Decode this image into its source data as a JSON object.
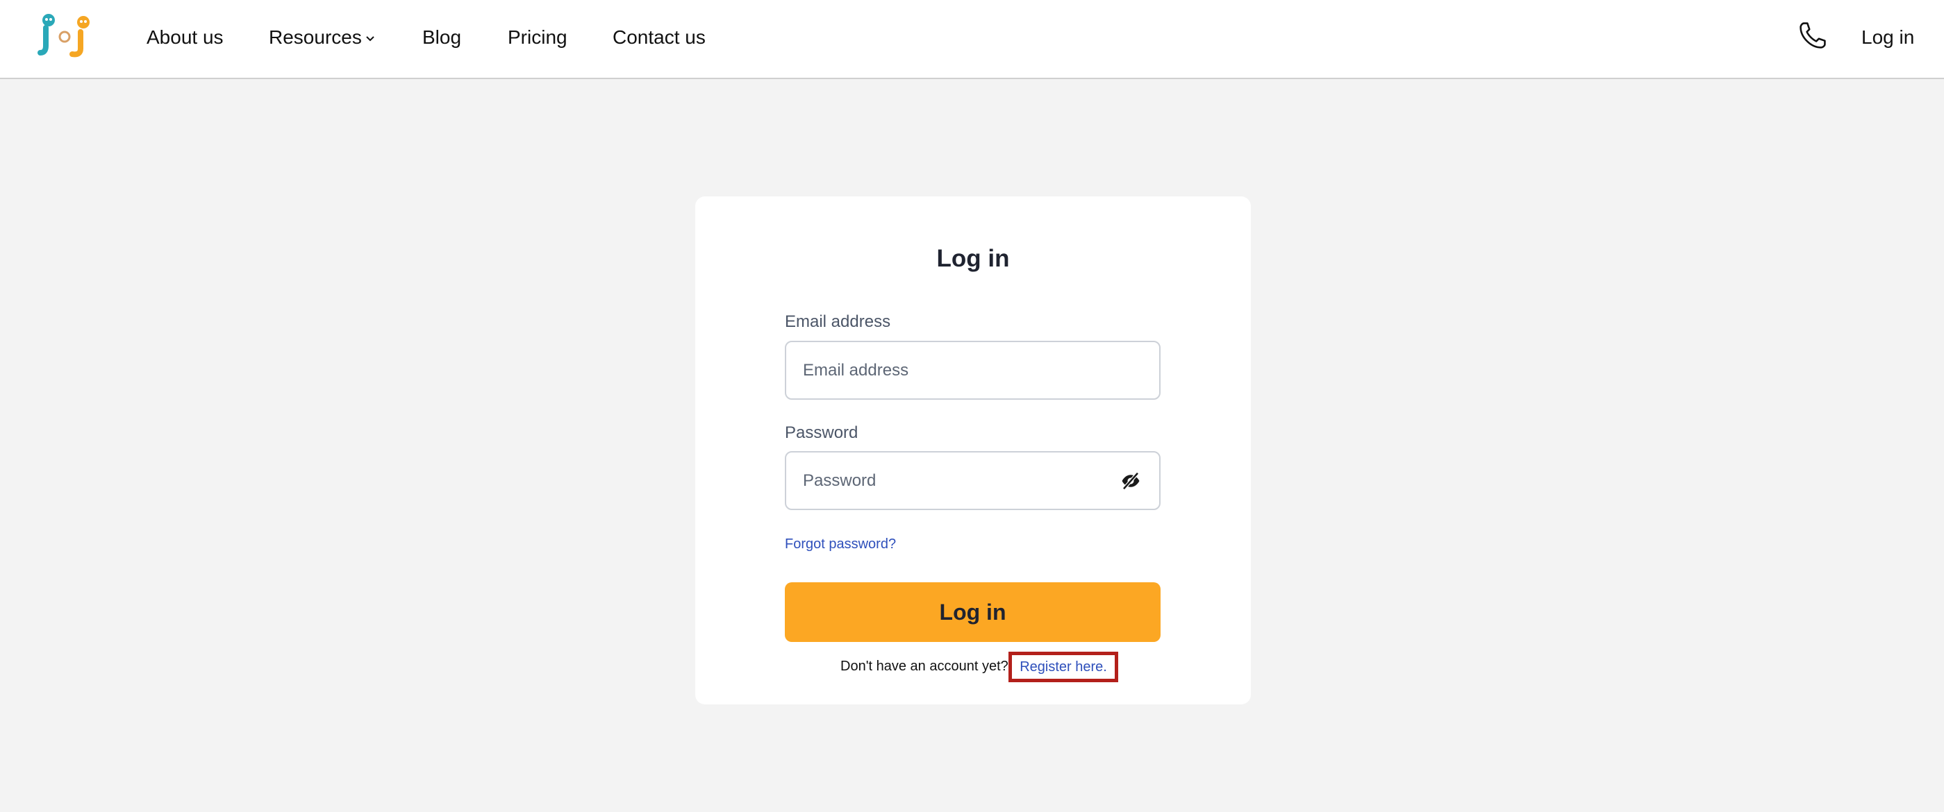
{
  "header": {
    "logo_text": "JJ",
    "nav": {
      "about": "About us",
      "resources": "Resources",
      "blog": "Blog",
      "pricing": "Pricing",
      "contact": "Contact us"
    },
    "login": "Log in"
  },
  "form": {
    "title": "Log in",
    "email_label": "Email address",
    "email_placeholder": "Email address",
    "password_label": "Password",
    "password_placeholder": "Password",
    "forgot_password": "Forgot password?",
    "submit_label": "Log in",
    "register_prompt": "Don't have an account yet?",
    "register_link": "Register here."
  },
  "icons": {
    "phone": "phone-icon",
    "eye": "eye-slash-icon",
    "chevron": "chevron-down-icon"
  },
  "colors": {
    "accent": "#fca723",
    "link": "#2e4fbb",
    "highlight_border": "#b3201b",
    "background": "#f3f3f3"
  }
}
